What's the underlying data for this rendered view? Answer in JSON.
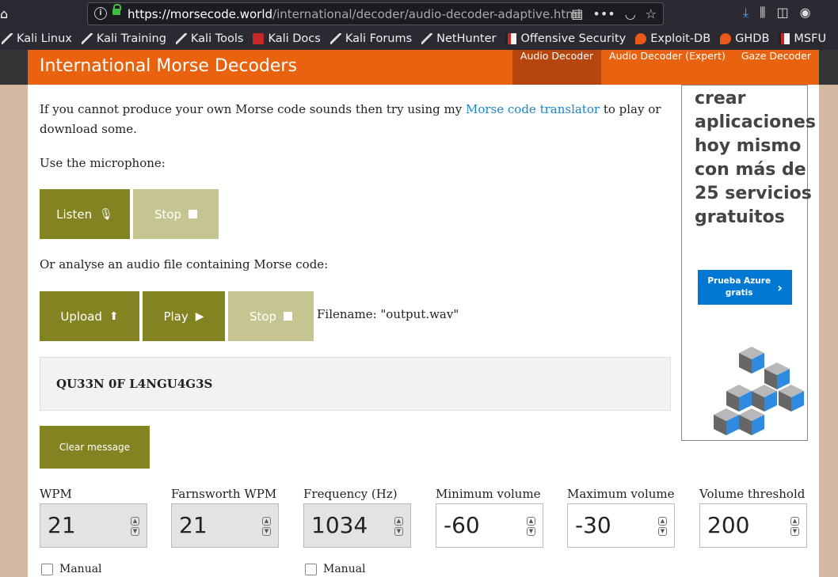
{
  "browser": {
    "url_host": "https://morsecode.world",
    "url_path": "/international/decoder/audio-decoder-adaptive.html"
  },
  "bookmarks": [
    {
      "label": "Kali Linux",
      "icon": "kali-dragon-icon"
    },
    {
      "label": "Kali Training",
      "icon": "kali-dragon-icon"
    },
    {
      "label": "Kali Tools",
      "icon": "kali-dragon-icon"
    },
    {
      "label": "Kali Docs",
      "icon": "kali-docs-icon"
    },
    {
      "label": "Kali Forums",
      "icon": "kali-dragon-icon"
    },
    {
      "label": "NetHunter",
      "icon": "kali-dragon-icon"
    },
    {
      "label": "Offensive Security",
      "icon": "offsec-icon"
    },
    {
      "label": "Exploit-DB",
      "icon": "exploitdb-icon"
    },
    {
      "label": "GHDB",
      "icon": "exploitdb-icon"
    },
    {
      "label": "MSFU",
      "icon": "offsec-icon"
    }
  ],
  "header": {
    "title": "International Morse Decoders",
    "nav": [
      "Audio Decoder",
      "Audio Decoder (Expert)",
      "Gaze Decoder"
    ]
  },
  "main": {
    "intro_before": "If you cannot produce your own Morse code sounds then try using my ",
    "intro_link": "Morse code translator",
    "intro_after": " to play or download some.",
    "mic_label": "Use the microphone:",
    "listen_label": "Listen",
    "stop_label": "Stop",
    "file_label": "Or analyse an audio file containing Morse code:",
    "upload_label": "Upload",
    "play_label": "Play",
    "filename": "Filename: \"output.wav\"",
    "message": "QU33N 0F L4NGU4G3S",
    "clear_label": "Clear message"
  },
  "fields": [
    {
      "label": "WPM",
      "value": "21",
      "disabled": true
    },
    {
      "label": "Farnsworth WPM",
      "value": "21",
      "disabled": true
    },
    {
      "label": "Frequency (Hz)",
      "value": "1034",
      "disabled": true
    },
    {
      "label": "Minimum volume",
      "value": "-60",
      "disabled": false
    },
    {
      "label": "Maximum volume",
      "value": "-30",
      "disabled": false
    },
    {
      "label": "Volume threshold",
      "value": "200",
      "disabled": false
    }
  ],
  "manual_label": "Manual",
  "ad": {
    "lines": [
      "crear",
      "aplicaciones",
      "hoy mismo",
      "con más de",
      "25 servicios",
      "gratuitos"
    ],
    "button": "Prueba Azure gratis"
  },
  "colors": {
    "header": "#e8620f",
    "button_dark": "#838321",
    "button_light": "#c4c591",
    "link": "#1a86c6",
    "ad_button": "#0078d4"
  }
}
